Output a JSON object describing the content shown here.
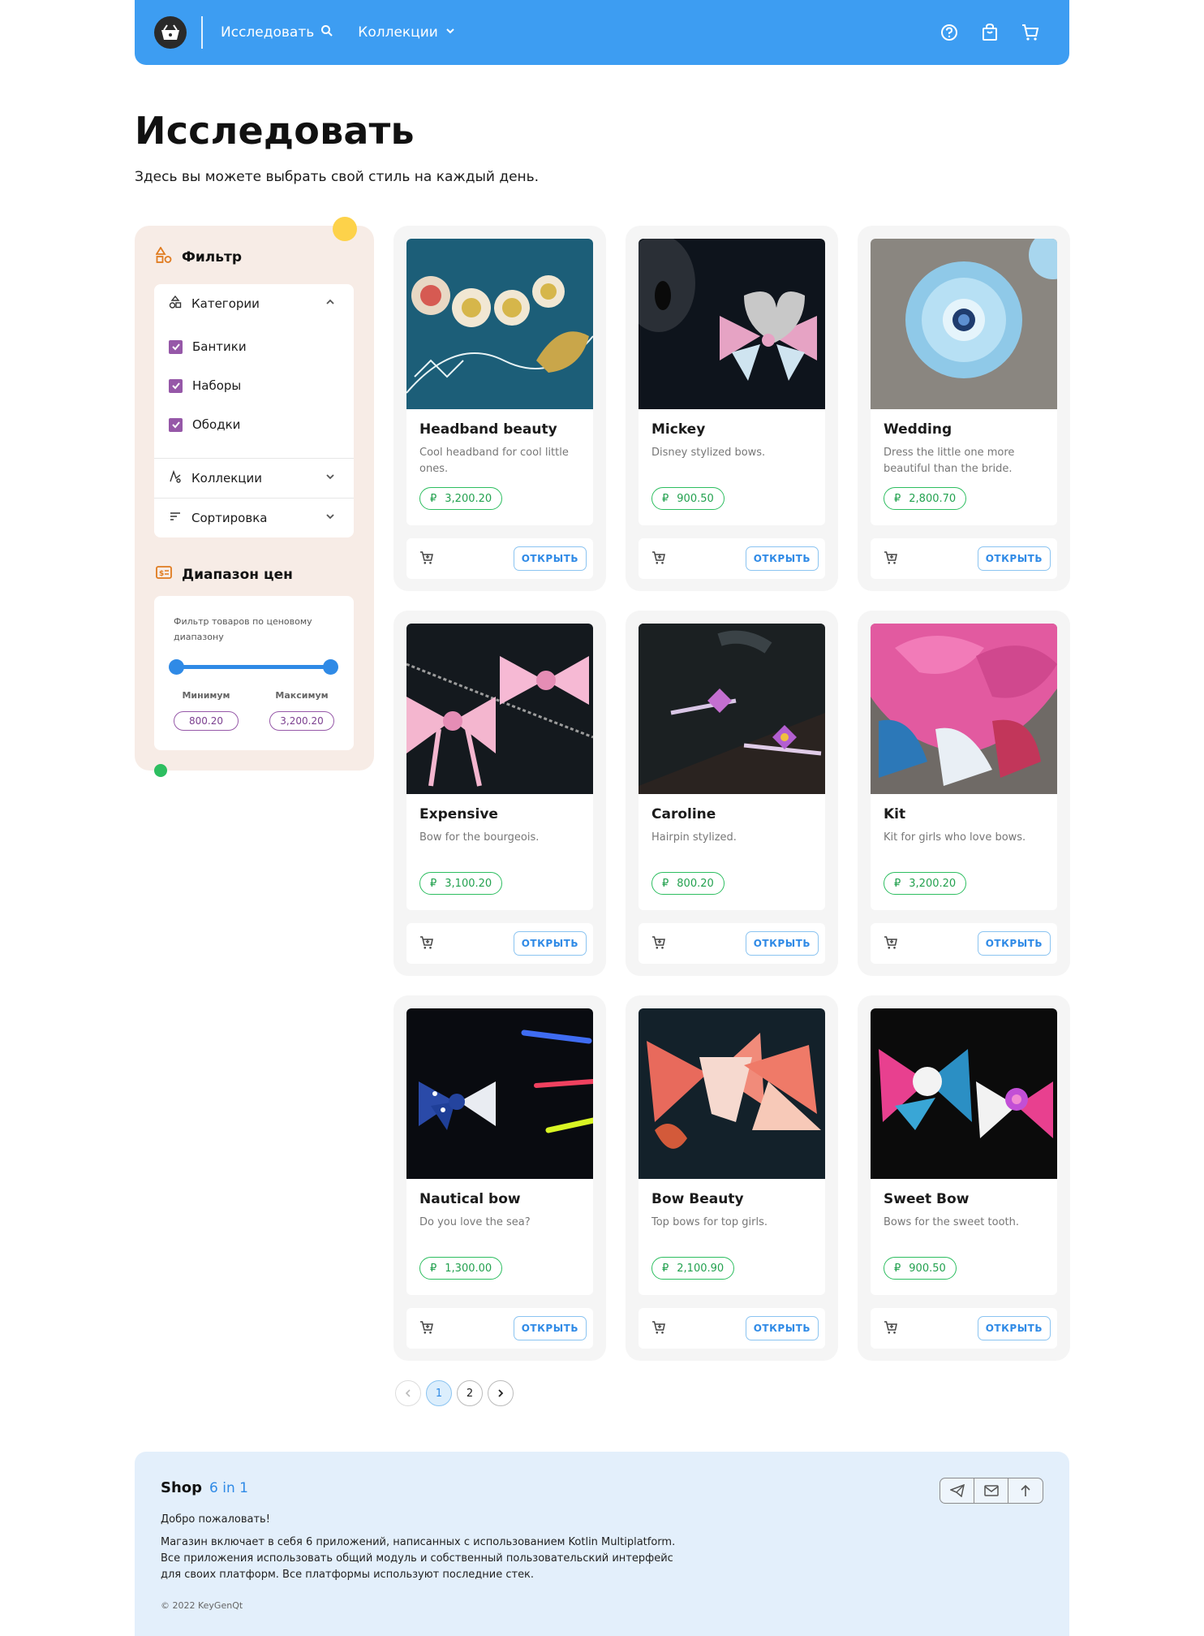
{
  "header": {
    "logo_icon": "shopping-basket-icon",
    "nav": [
      {
        "label": "Исследовать",
        "icon": "search-icon"
      },
      {
        "label": "Коллекции",
        "icon": "chevron-down-icon"
      }
    ],
    "right_icons": [
      "help-icon",
      "shopping-bag-icon",
      "cart-icon"
    ],
    "bg_color": "#3d9df2"
  },
  "page": {
    "title": "Исследовать",
    "subtitle": "Здесь вы можете выбрать свой стиль на каждый день."
  },
  "filter": {
    "title": "Фильтр",
    "categories": {
      "label": "Категории",
      "items": [
        {
          "label": "Бантики",
          "checked": true
        },
        {
          "label": "Наборы",
          "checked": true
        },
        {
          "label": "Ободки",
          "checked": true
        }
      ]
    },
    "collections_label": "Коллекции",
    "sort_label": "Сортировка",
    "price_range": {
      "title": "Диапазон цен",
      "description": "Фильтр товаров по ценовому диапазону",
      "min_label": "Минимум",
      "max_label": "Максимум",
      "min_value": "800.20",
      "max_value": "3,200.20"
    }
  },
  "currency_symbol": "₽",
  "open_label": "ОТКРЫТЬ",
  "products": [
    {
      "name": "Headband beauty",
      "description": "Cool headband for cool little ones.",
      "price": "3,200.20"
    },
    {
      "name": "Mickey",
      "description": "Disney stylized bows.",
      "price": "900.50"
    },
    {
      "name": "Wedding",
      "description": "Dress the little one more beautiful than the bride.",
      "price": "2,800.70"
    },
    {
      "name": "Expensive",
      "description": "Bow for the bourgeois.",
      "price": "3,100.20"
    },
    {
      "name": "Caroline",
      "description": "Hairpin stylized.",
      "price": "800.20"
    },
    {
      "name": "Kit",
      "description": "Kit for girls who love bows.",
      "price": "3,200.20"
    },
    {
      "name": "Nautical bow",
      "description": "Do you love the sea?",
      "price": "1,300.00"
    },
    {
      "name": "Bow Beauty",
      "description": "Top bows for top girls.",
      "price": "2,100.90"
    },
    {
      "name": "Sweet Bow",
      "description": "Bows for the sweet tooth.",
      "price": "900.50"
    }
  ],
  "pagination": {
    "pages": [
      "1",
      "2"
    ],
    "current": "1"
  },
  "footer": {
    "title": "Shop",
    "title_accent": "6 in 1",
    "welcome": "Добро пожаловать!",
    "lines": [
      "Магазин включает в себя 6 приложений, написанных с использованием Kotlin Multiplatform.",
      "Все приложения использовать общий модуль и собственный пользовательский интерфейс",
      "для своих платформ. Все платформы используют последние стек."
    ],
    "copyright": "© 2022 KeyGenQt",
    "action_icons": [
      "telegram-icon",
      "mail-icon",
      "arrow-up-icon"
    ]
  }
}
